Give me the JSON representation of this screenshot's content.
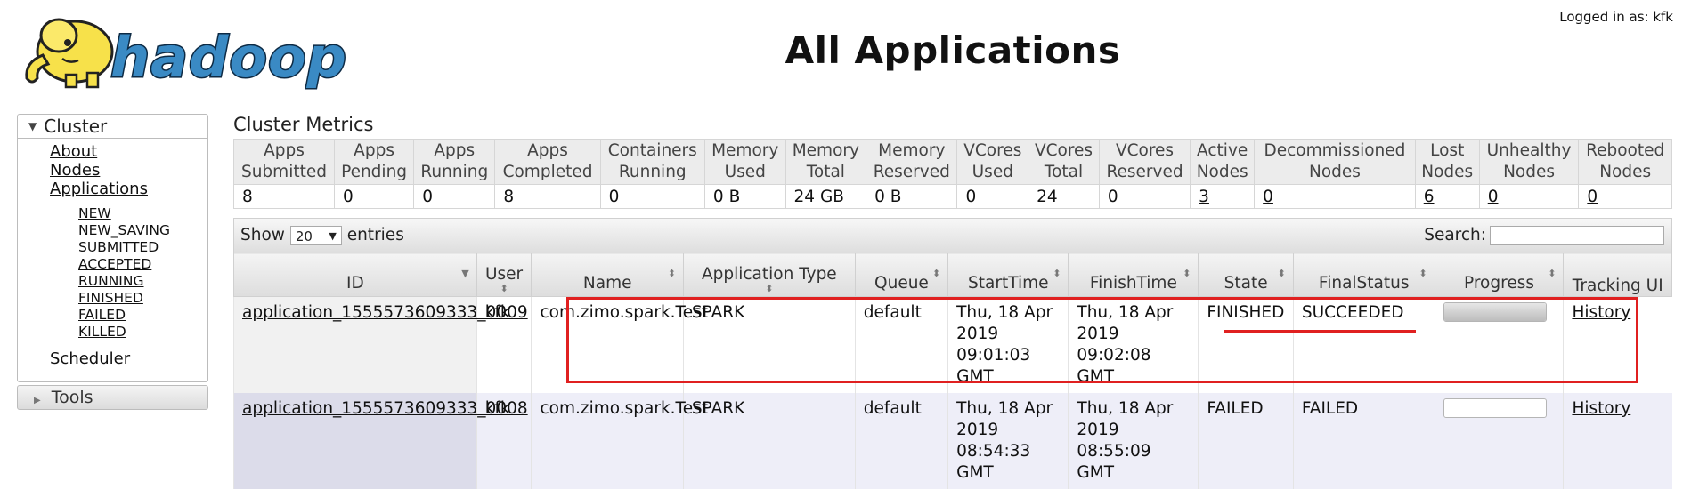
{
  "header": {
    "title": "All Applications",
    "logged_in": "Logged in as: kfk",
    "logo_text": "hadoop"
  },
  "sidebar": {
    "cluster_label": "Cluster",
    "links": [
      "About",
      "Nodes",
      "Applications"
    ],
    "app_states": [
      "NEW",
      "NEW_SAVING",
      "SUBMITTED",
      "ACCEPTED",
      "RUNNING",
      "FINISHED",
      "FAILED",
      "KILLED"
    ],
    "scheduler": "Scheduler",
    "tools_label": "Tools"
  },
  "metrics": {
    "title": "Cluster Metrics",
    "headers": [
      [
        "Apps",
        "Submitted"
      ],
      [
        "Apps",
        "Pending"
      ],
      [
        "Apps",
        "Running"
      ],
      [
        "Apps",
        "Completed"
      ],
      [
        "Containers",
        "Running"
      ],
      [
        "Memory",
        "Used"
      ],
      [
        "Memory",
        "Total"
      ],
      [
        "Memory",
        "Reserved"
      ],
      [
        "VCores",
        "Used"
      ],
      [
        "VCores",
        "Total"
      ],
      [
        "VCores",
        "Reserved"
      ],
      [
        "Active",
        "Nodes"
      ],
      [
        "Decommissioned",
        "Nodes"
      ],
      [
        "Lost",
        "Nodes"
      ],
      [
        "Unhealthy",
        "Nodes"
      ],
      [
        "Rebooted",
        "Nodes"
      ]
    ],
    "values": [
      "8",
      "0",
      "0",
      "8",
      "0",
      "0 B",
      "24 GB",
      "0 B",
      "0",
      "24",
      "0",
      "3",
      "0",
      "6",
      "0",
      "0"
    ],
    "linked": [
      11,
      12,
      13,
      14,
      15
    ]
  },
  "controls": {
    "show": "Show",
    "entries_value": "20",
    "entries": "entries",
    "search_label": "Search:",
    "search_value": ""
  },
  "apps_table": {
    "columns": [
      [
        "ID"
      ],
      [
        "User"
      ],
      [
        "Name"
      ],
      [
        "Application Type"
      ],
      [
        "Queue"
      ],
      [
        "StartTime"
      ],
      [
        "FinishTime"
      ],
      [
        "State"
      ],
      [
        "FinalStatus"
      ],
      [
        "Progress"
      ],
      [
        "Tracking UI"
      ]
    ],
    "rows": [
      {
        "id": "application_1555573609333_0009",
        "user": "kfk",
        "name": "com.zimo.spark.Test",
        "type": "SPARK",
        "queue": "default",
        "start": [
          "Thu, 18 Apr",
          "2019",
          "09:01:03",
          "GMT"
        ],
        "finish": [
          "Thu, 18 Apr",
          "2019",
          "09:02:08 GMT"
        ],
        "state": "FINISHED",
        "final_status": "SUCCEEDED",
        "progress": 1.0,
        "tracking": "History"
      },
      {
        "id": "application_1555573609333_0008",
        "user": "kfk",
        "name": "com.zimo.spark.Test",
        "type": "SPARK",
        "queue": "default",
        "start": [
          "Thu, 18 Apr",
          "2019",
          "08:54:33",
          "GMT"
        ],
        "finish": [
          "Thu, 18 Apr",
          "2019",
          "08:55:09 GMT"
        ],
        "state": "FAILED",
        "final_status": "FAILED",
        "progress": 0.0,
        "tracking": "History"
      }
    ]
  },
  "colors": {
    "highlight": "#e02020",
    "logo_yellow": "#f7e14a",
    "logo_blue": "#3a8ac4"
  }
}
